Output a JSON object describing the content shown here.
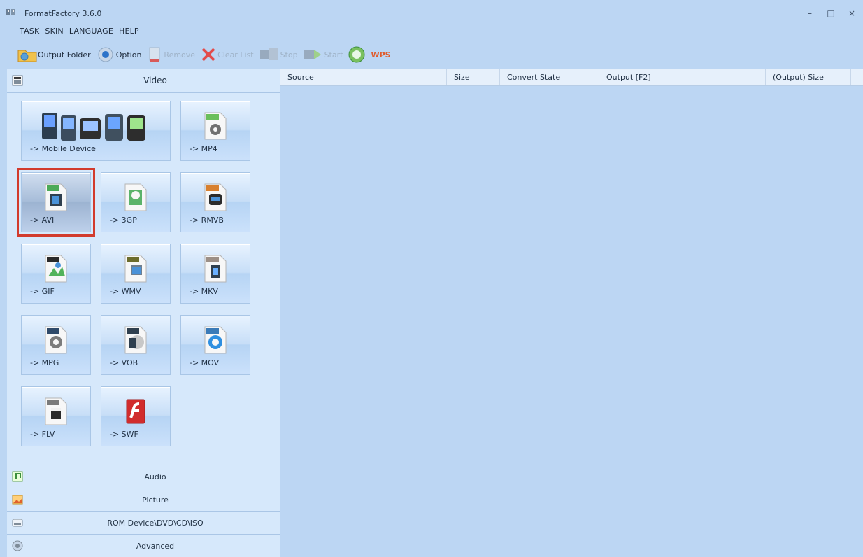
{
  "app": {
    "title": "FormatFactory 3.6.0"
  },
  "window_controls": {
    "minimize": "–",
    "maximize": "□",
    "close": "×"
  },
  "menus": [
    "TASK",
    "SKIN",
    "LANGUAGE",
    "HELP"
  ],
  "toolbar": {
    "output_folder": "Output Folder",
    "option": "Option",
    "remove": "Remove",
    "clear_list": "Clear List",
    "stop": "Stop",
    "start": "Start",
    "wps": "WPS"
  },
  "sidebar": {
    "category_video": "Video",
    "tiles": {
      "mobile_device": "-> Mobile Device",
      "mp4": "-> MP4",
      "avi": "-> AVI",
      "3gp": "-> 3GP",
      "rmvb": "-> RMVB",
      "gif": "-> GIF",
      "wmv": "-> WMV",
      "mkv": "-> MKV",
      "mpg": "-> MPG",
      "vob": "-> VOB",
      "mov": "-> MOV",
      "flv": "-> FLV",
      "swf": "-> SWF"
    },
    "footer": {
      "audio": "Audio",
      "picture": "Picture",
      "rom": "ROM Device\\DVD\\CD\\ISO",
      "advanced": "Advanced"
    }
  },
  "table": {
    "columns": [
      "Source",
      "Size",
      "Convert State",
      "Output [F2]",
      "(Output) Size"
    ]
  },
  "colors": {
    "window_bg": "#bcd6f3",
    "sidebar_bg": "#d6e8fb",
    "selected_outline": "#d23b2d",
    "wps_text": "#e05b2b"
  }
}
